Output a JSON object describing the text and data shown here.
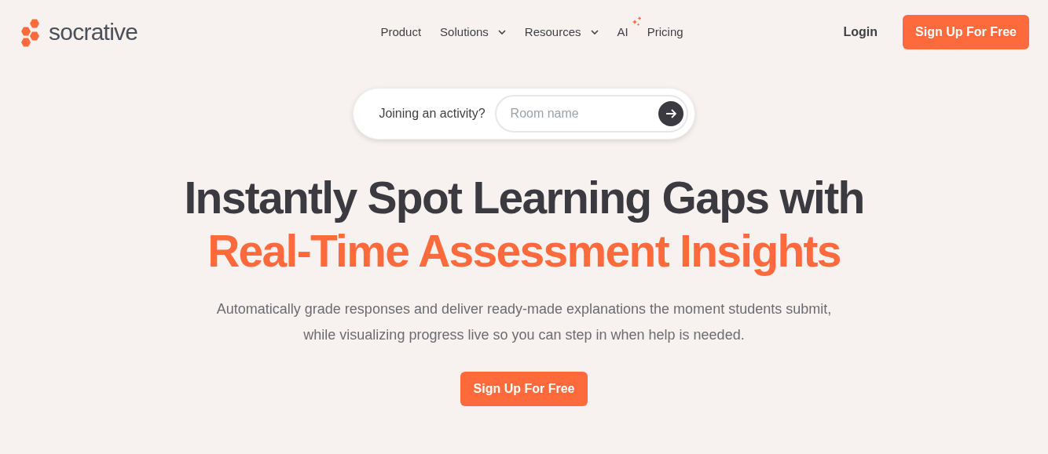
{
  "header": {
    "logo": "socrative",
    "nav": [
      {
        "label": "Product",
        "kind": "link"
      },
      {
        "label": "Solutions",
        "kind": "dropdown"
      },
      {
        "label": "Resources",
        "kind": "dropdown"
      },
      {
        "label": "AI",
        "kind": "sparkle"
      },
      {
        "label": "Pricing",
        "kind": "link"
      }
    ],
    "login": "Login",
    "signup": "Sign Up For Free"
  },
  "join": {
    "label": "Joining an activity?",
    "placeholder": "Room name"
  },
  "hero": {
    "headline": "Instantly Spot Learning Gaps with",
    "highlight": "Real-Time Assessment Insights",
    "description": "Automatically grade responses and deliver ready-made explanations the moment students submit, while visualizing progress live so you can step in when help is needed.",
    "cta": "Sign Up For Free"
  }
}
